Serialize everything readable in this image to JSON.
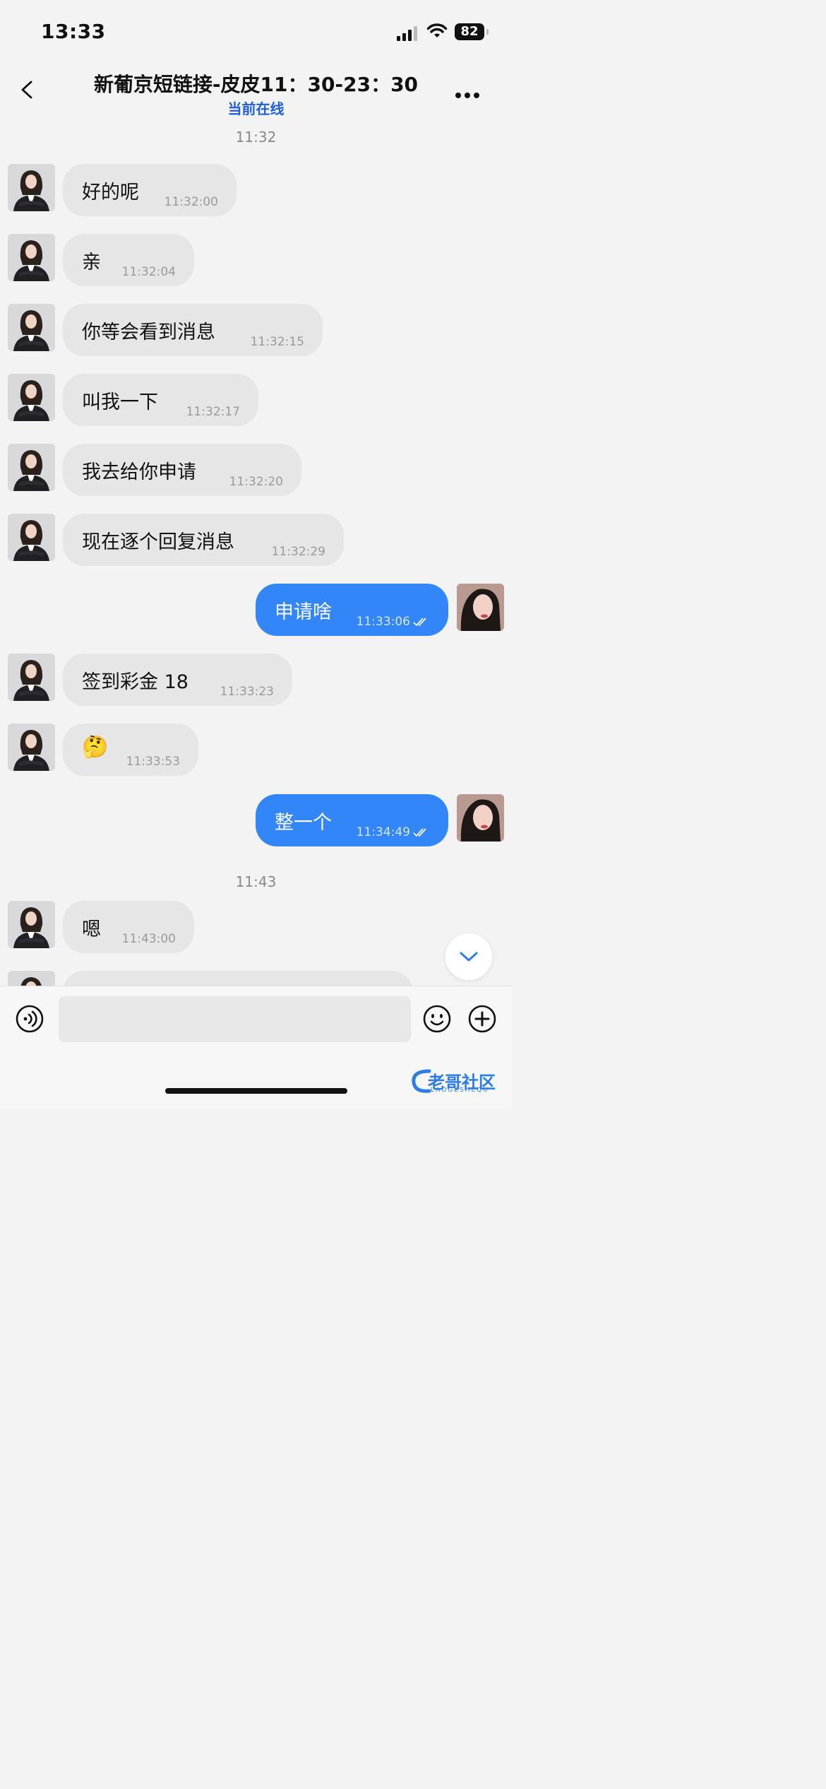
{
  "status_bar": {
    "time": "13:33",
    "battery": "82"
  },
  "header": {
    "title": "新葡京短链接-皮皮11：30-23：30",
    "subtitle": "当前在线"
  },
  "dividers": [
    "11:32",
    "11:43"
  ],
  "messages": [
    {
      "dir": "in",
      "text": "好的呢",
      "time": "11:32:00"
    },
    {
      "dir": "in",
      "text": "亲",
      "time": "11:32:04"
    },
    {
      "dir": "in",
      "text": "你等会看到消息",
      "time": "11:32:15"
    },
    {
      "dir": "in",
      "text": "叫我一下",
      "time": "11:32:17"
    },
    {
      "dir": "in",
      "text": "我去给你申请",
      "time": "11:32:20"
    },
    {
      "dir": "in",
      "text": "现在逐个回复消息",
      "time": "11:32:29"
    },
    {
      "dir": "out",
      "text": "申请啥",
      "time": "11:33:06",
      "status": "read"
    },
    {
      "dir": "in",
      "text": "签到彩金  18",
      "time": "11:33:23"
    },
    {
      "dir": "in",
      "text": "🤔",
      "time": "11:33:53",
      "emoji": "thinking-face"
    },
    {
      "dir": "out",
      "text": "整一个",
      "time": "11:34:49",
      "status": "read"
    },
    {
      "dir": "in",
      "text": "嗯",
      "time": "11:43:00"
    }
  ],
  "watermark": {
    "text": "老哥社区",
    "sub": "LAOGESHEQU"
  },
  "colors": {
    "accent": "#3286f7",
    "incoming_bubble": "#e6e6e6",
    "online": "#1f5fd6"
  }
}
